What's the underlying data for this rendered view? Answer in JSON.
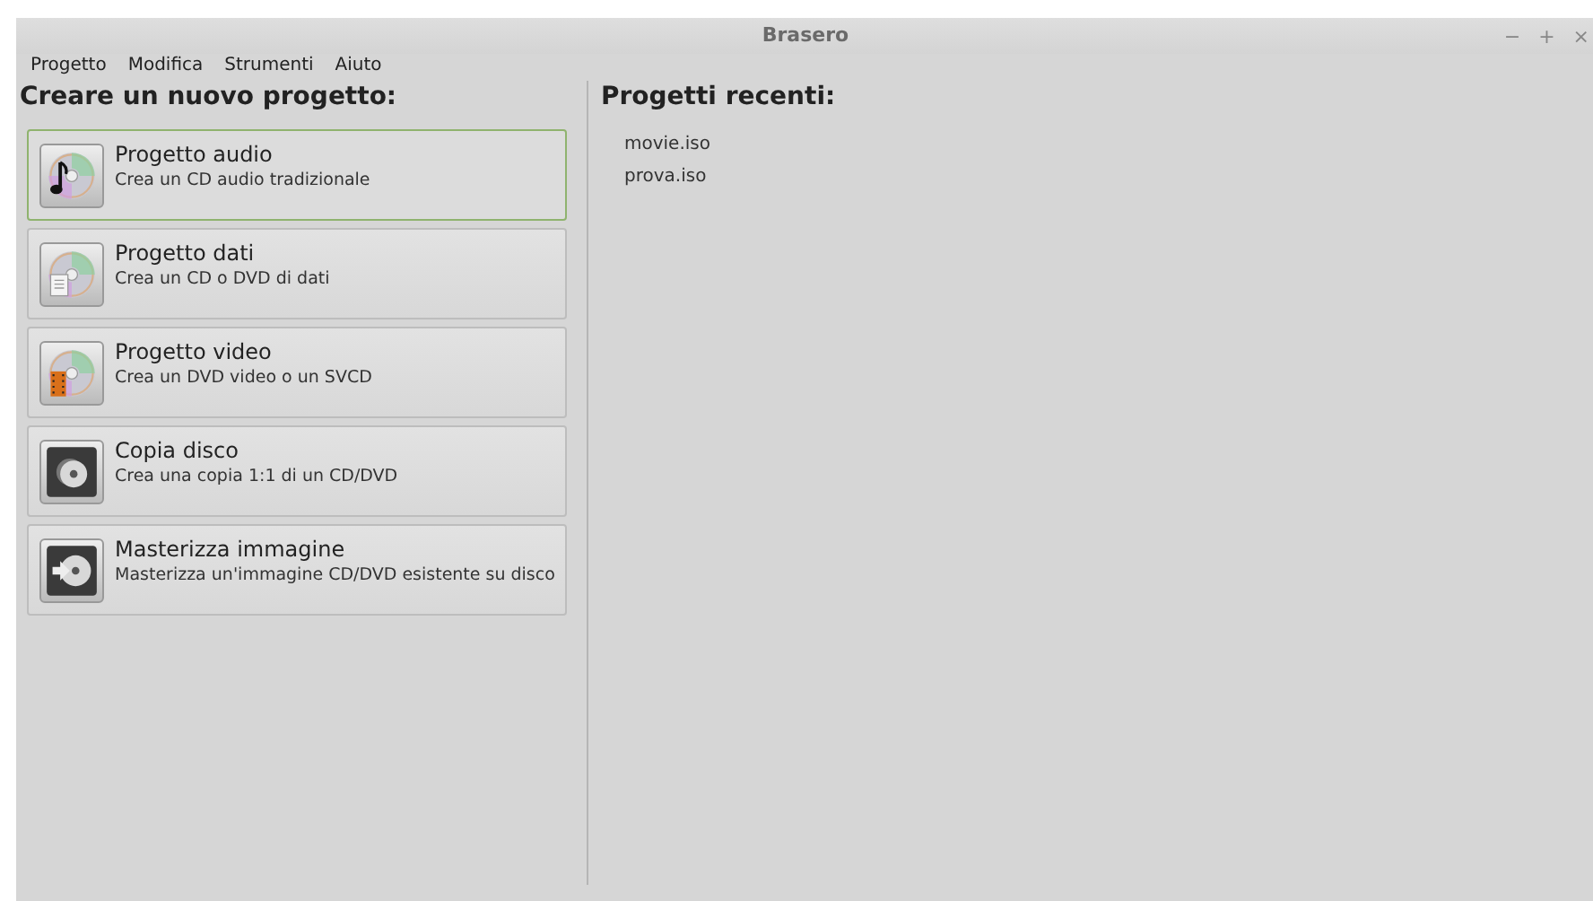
{
  "window": {
    "title": "Brasero",
    "controls": [
      "−",
      "+",
      "×"
    ]
  },
  "menu": [
    "Progetto",
    "Modifica",
    "Strumenti",
    "Aiuto"
  ],
  "new_project": {
    "heading": "Creare un nuovo progetto:",
    "items": [
      {
        "kind": "audio",
        "title": "Progetto audio",
        "description": "Crea un CD audio tradizionale",
        "selected": true
      },
      {
        "kind": "data",
        "title": "Progetto dati",
        "description": "Crea un CD o DVD di dati",
        "selected": false
      },
      {
        "kind": "video",
        "title": "Progetto video",
        "description": "Crea un DVD video o un SVCD",
        "selected": false
      },
      {
        "kind": "copy",
        "title": "Copia disco",
        "description": "Crea una copia 1:1 di un CD/DVD",
        "selected": false
      },
      {
        "kind": "image",
        "title": "Masterizza immagine",
        "description": "Masterizza un'immagine CD/DVD esistente su disco",
        "selected": false
      }
    ]
  },
  "recent_projects": {
    "heading": "Progetti recenti:",
    "items": [
      "movie.iso",
      "prova.iso"
    ]
  }
}
